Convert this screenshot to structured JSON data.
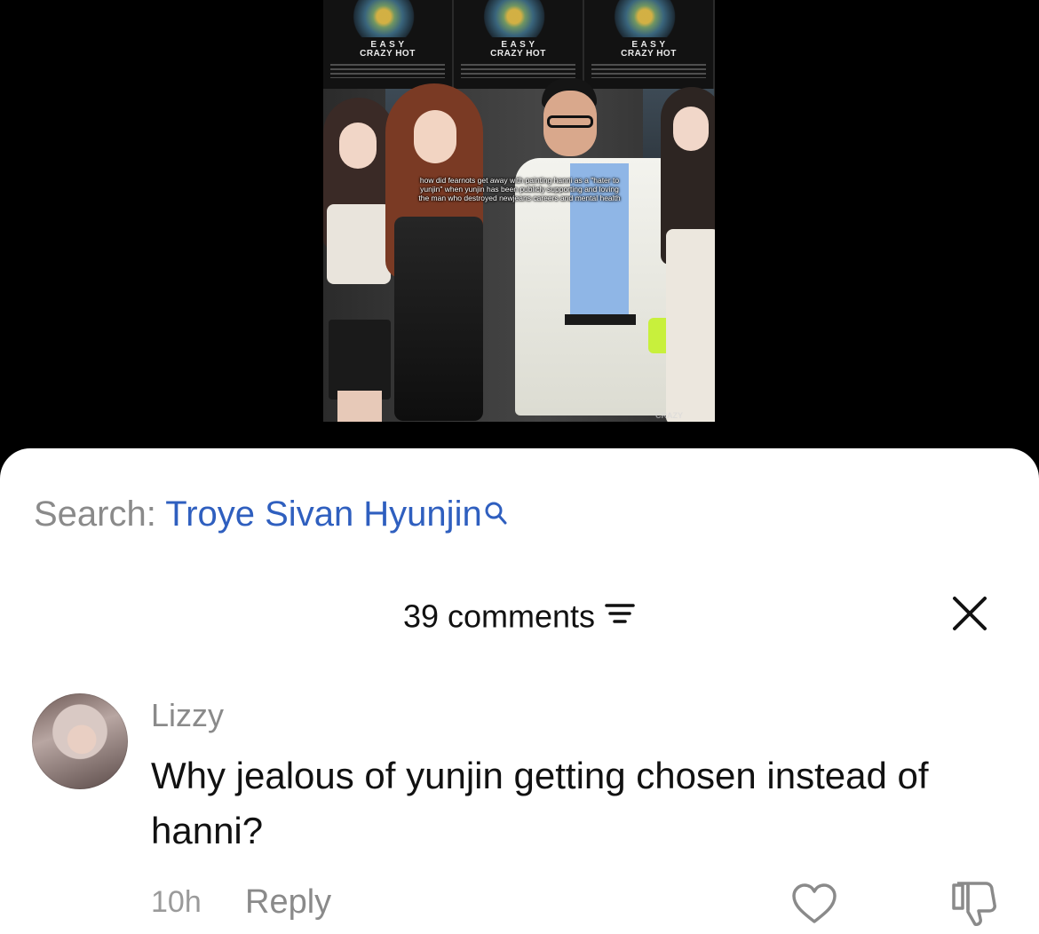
{
  "video": {
    "poster_logo": "E A S Y\nCRAZY HOT",
    "caption": "how did fearnots get away with painting hanni as a \"hater to yunjin\" when yunjin has been publicly supporting and loving the man who destroyed newjeans careers and mental health",
    "watermark": "CRAZY"
  },
  "search": {
    "label": "Search:",
    "term": "Troye Sivan Hyunjin",
    "icon": "search-icon",
    "term_color": "#2f5fbf"
  },
  "comments_header": {
    "count_text": "39 comments",
    "filter_icon": "filter-icon",
    "close_icon": "close-icon"
  },
  "comment": {
    "username": "Lizzy",
    "text": "Why jealous of yunjin getting chosen instead of hanni?",
    "time": "10h",
    "reply_label": "Reply",
    "like_icon": "heart-icon",
    "dislike_icon": "thumbs-down-icon"
  }
}
